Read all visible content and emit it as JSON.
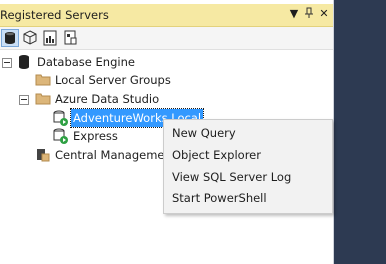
{
  "panel": {
    "title": "Registered Servers",
    "buttons": [
      "▼",
      "⊥",
      "✕"
    ]
  },
  "toolbar": {
    "items": [
      "database-engine-icon",
      "analysis-services-icon",
      "reporting-services-icon",
      "integration-services-icon"
    ]
  },
  "tree": {
    "root": "Database Engine",
    "local_server_groups": "Local Server Groups",
    "azure_data_studio": "Azure Data Studio",
    "server_selected": "AdventureWorks Local",
    "server_express": "Express",
    "central_management": "Central Management Servers"
  },
  "context_menu": {
    "items": [
      "New Query",
      "Object Explorer",
      "View SQL Server Log",
      "Start PowerShell"
    ]
  },
  "colors": {
    "title_bg": "#f6e9a3",
    "selection": "#3399ff",
    "background_dark": "#2d3a52"
  }
}
